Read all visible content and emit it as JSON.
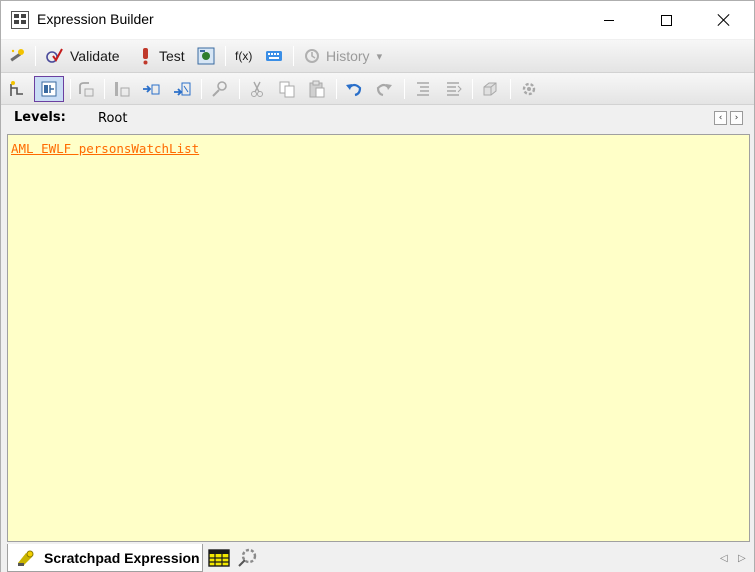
{
  "window": {
    "title": "Expression Builder",
    "controls": [
      "minimize",
      "maximize",
      "close"
    ]
  },
  "toolbar1": {
    "validate_label": "Validate",
    "test_label": "Test",
    "fx_label": "f(x)",
    "history_label": "History"
  },
  "levels": {
    "label": "Levels:",
    "value": "Root"
  },
  "editor": {
    "background": "#ffffc8",
    "expression_link": "AML EWLF personsWatchList",
    "link_color": "#ff6a00"
  },
  "bottom_tabs": {
    "active_tab_label": "Scratchpad Expression"
  },
  "icons": {
    "nav_left": "‹",
    "nav_right": "›",
    "scroll_left": "◁",
    "scroll_right": "▷",
    "dropdown": "▾"
  }
}
